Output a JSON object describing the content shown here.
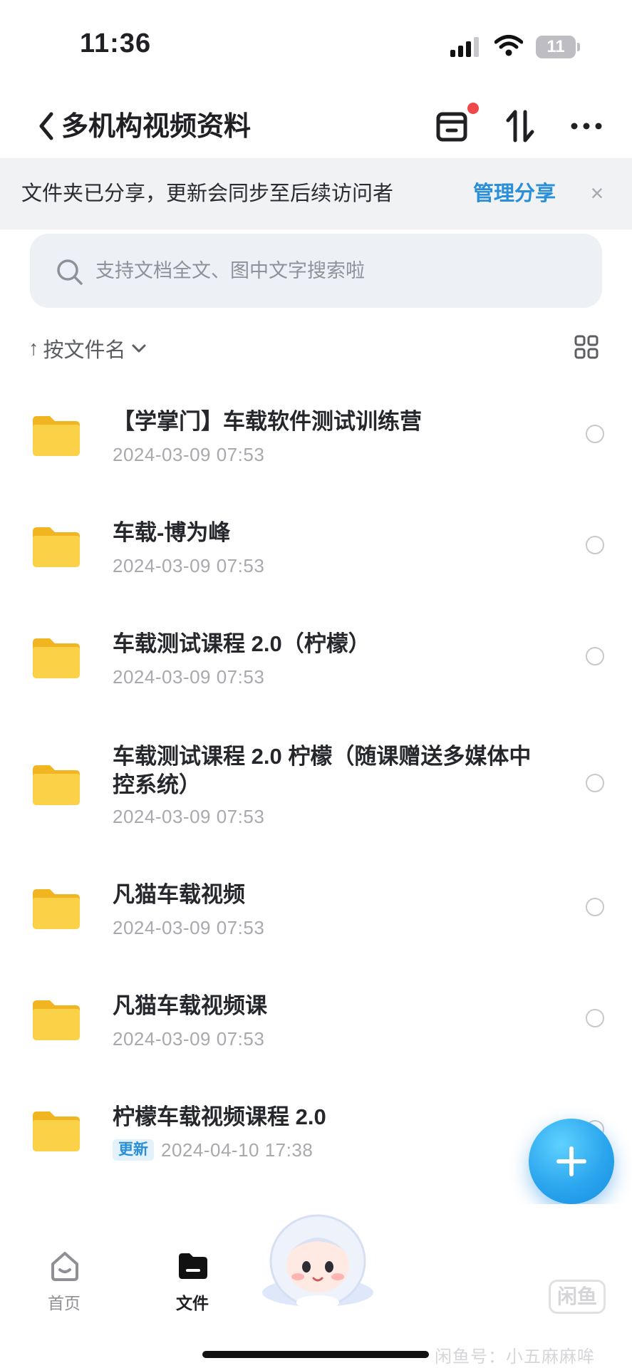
{
  "status_bar": {
    "time": "11:36",
    "battery": "11"
  },
  "header": {
    "title": "多机构视频资料"
  },
  "share_banner": {
    "text": "文件夹已分享，更新会同步至后续访问者",
    "link": "管理分享",
    "close": "×"
  },
  "search": {
    "placeholder": "支持文档全文、图中文字搜索啦"
  },
  "sort": {
    "arrow": "↑",
    "label": "按文件名"
  },
  "files": [
    {
      "name": "【学掌门】车载软件测试训练营",
      "date": "2024-03-09 07:53"
    },
    {
      "name": "车载-博为峰",
      "date": "2024-03-09 07:53"
    },
    {
      "name": "车载测试课程 2.0（柠檬）",
      "date": "2024-03-09 07:53"
    },
    {
      "name": "车载测试课程 2.0 柠檬（随课赠送多媒体中控系统）",
      "date": "2024-03-09 07:53"
    },
    {
      "name": "凡猫车载视频",
      "date": "2024-03-09 07:53"
    },
    {
      "name": "凡猫车载视频课",
      "date": "2024-03-09 07:53"
    },
    {
      "name": "柠檬车载视频课程 2.0",
      "date": "2024-04-10 17:38",
      "badge": "更新"
    }
  ],
  "tabs": {
    "home": "首页",
    "files": "文件"
  },
  "watermark": {
    "logo": "闲鱼",
    "text": "闲鱼号：小五麻麻哞"
  },
  "colors": {
    "accent": "#2a8fd9",
    "folder": "#f9c93c",
    "fab": "#2ba6ee"
  }
}
